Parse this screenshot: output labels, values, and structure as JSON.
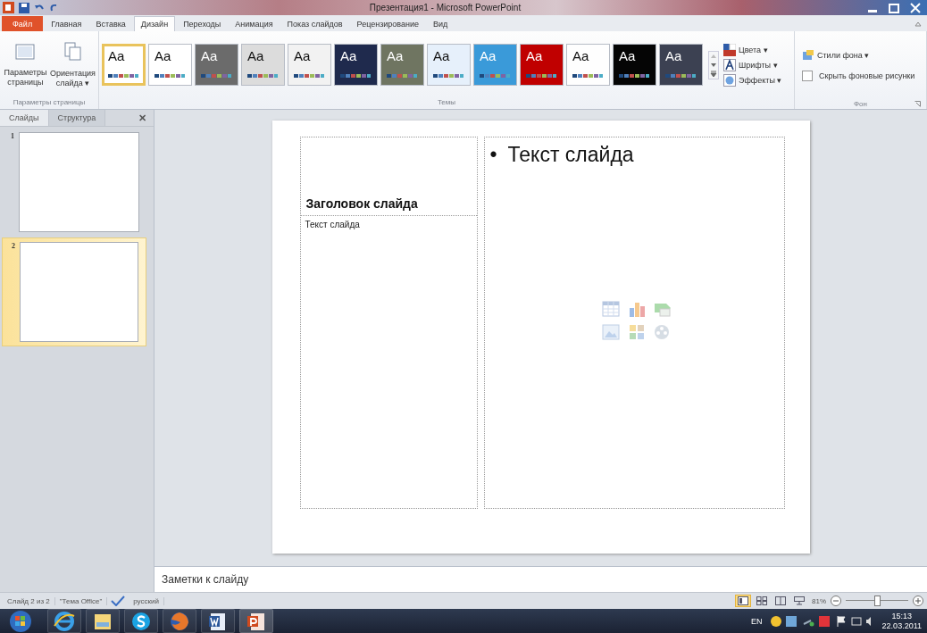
{
  "window": {
    "title": "Презентация1 - Microsoft PowerPoint"
  },
  "ribbon_tabs": [
    {
      "label": "Файл",
      "kind": "file",
      "selected": false
    },
    {
      "label": "Главная",
      "kind": "tab",
      "selected": false
    },
    {
      "label": "Вставка",
      "kind": "tab",
      "selected": false
    },
    {
      "label": "Дизайн",
      "kind": "tab",
      "selected": true
    },
    {
      "label": "Переходы",
      "kind": "tab",
      "selected": false
    },
    {
      "label": "Анимация",
      "kind": "tab",
      "selected": false
    },
    {
      "label": "Показ слайдов",
      "kind": "tab",
      "selected": false
    },
    {
      "label": "Рецензирование",
      "kind": "tab",
      "selected": false
    },
    {
      "label": "Вид",
      "kind": "tab",
      "selected": false
    }
  ],
  "page_setup": {
    "buttons": [
      {
        "label": "Параметры страницы",
        "kind": "page"
      },
      {
        "label": "Ориентация слайда ▾",
        "kind": "orient"
      }
    ],
    "group_label": "Параметры страницы"
  },
  "themes": {
    "items": [
      {
        "label": "Aa",
        "color": "#ffffff",
        "selected": true
      },
      {
        "label": "Aa",
        "color": "#ffffff",
        "selected": false
      },
      {
        "label": "Aa",
        "color": "#6b6b6b",
        "selected": false
      },
      {
        "label": "Aa",
        "color": "#dcdcdc",
        "selected": false
      },
      {
        "label": "Aa",
        "color": "#f2f2f2",
        "selected": false
      },
      {
        "label": "Aa",
        "color": "#1f2a4d",
        "selected": false
      },
      {
        "label": "Aa",
        "color": "#6f7561",
        "selected": false
      },
      {
        "label": "Aa",
        "color": "#e6f0fb",
        "selected": false
      },
      {
        "label": "Aa",
        "color": "#3a9ad9",
        "selected": false
      },
      {
        "label": "Aa",
        "color": "#c00000",
        "selected": false
      },
      {
        "label": "Aa",
        "color": "#fefefe",
        "selected": false
      },
      {
        "label": "Aa",
        "color": "#050505",
        "selected": false
      },
      {
        "label": "Aa",
        "color": "#3c4152",
        "selected": false
      }
    ],
    "options": [
      {
        "label": "Цвета ▾",
        "kind": "colors"
      },
      {
        "label": "Шрифты ▾",
        "kind": "fonts"
      },
      {
        "label": "Эффекты ▾",
        "kind": "effects"
      }
    ],
    "group_label": "Темы"
  },
  "background": {
    "styles": "Стили фона ▾",
    "hide_graphics": {
      "label": "Скрыть фоновые рисунки",
      "checked": false
    },
    "group_label": "Фон"
  },
  "panel": {
    "tabs": [
      {
        "label": "Слайды",
        "selected": true
      },
      {
        "label": "Структура",
        "selected": false
      }
    ],
    "close": "✕",
    "slides": [
      {
        "number": "1",
        "selected": false
      },
      {
        "number": "2",
        "selected": true
      }
    ]
  },
  "slide": {
    "title": "Заголовок слайда",
    "text": "Текст слайда",
    "bullet_mark": "•",
    "bullet": "Текст слайда"
  },
  "notes": {
    "placeholder": "Заметки к слайду"
  },
  "status_bar": {
    "items": [
      "Слайд 2 из 2",
      "\"Тема Office\"",
      "русский"
    ],
    "views": [
      {
        "kind": "normal",
        "selected": true
      },
      {
        "kind": "sorter",
        "selected": false
      },
      {
        "kind": "reading",
        "selected": false
      },
      {
        "kind": "show",
        "selected": false
      }
    ],
    "zoom": "81%",
    "zoom_level": {
      "level": 0.5
    }
  },
  "taskbar": {
    "apps": [
      {
        "kind": "start"
      },
      {
        "kind": "ie"
      },
      {
        "kind": "folder"
      },
      {
        "kind": "skype"
      },
      {
        "kind": "firefox"
      },
      {
        "kind": "word"
      },
      {
        "kind": "powerpoint"
      }
    ],
    "language": "EN",
    "time": "15:13",
    "date": "22.03.2011"
  }
}
